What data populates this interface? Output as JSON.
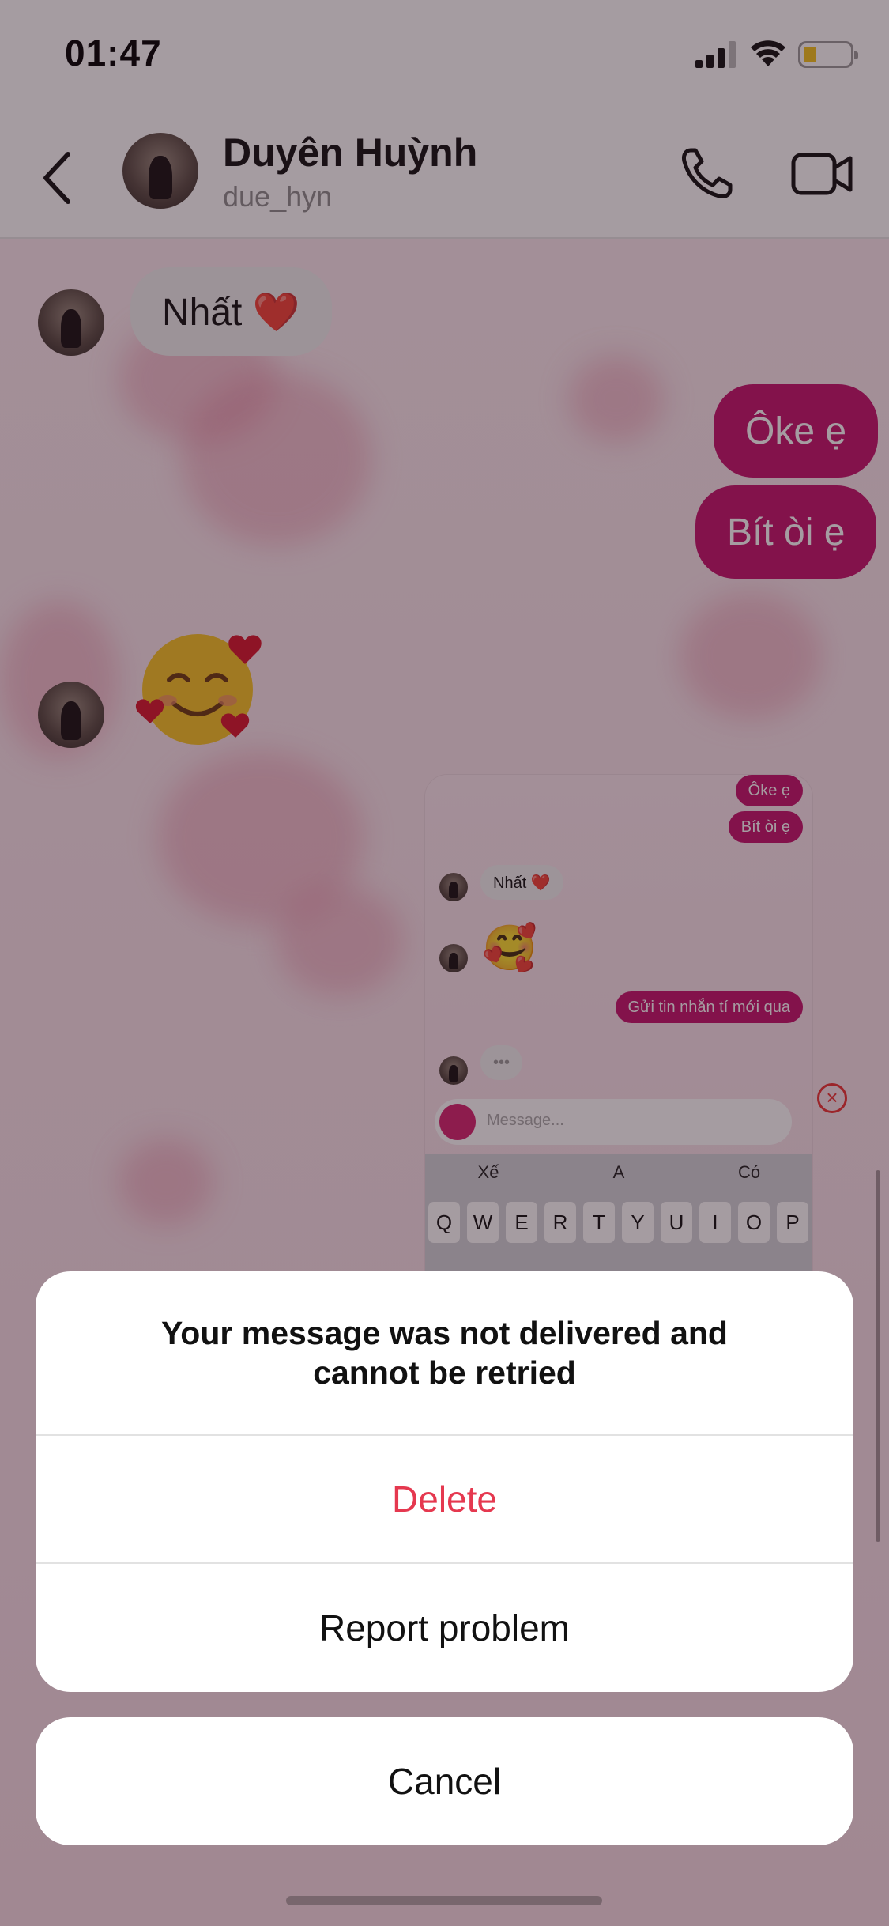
{
  "status_bar": {
    "time": "01:47"
  },
  "header": {
    "contact_name": "Duyên Huỳnh",
    "handle": "due_hyn"
  },
  "messages": {
    "m1": "Nhất ❤️",
    "m2": "Ôke ẹ",
    "m3": "Bít òi ẹ",
    "m4": "☺️"
  },
  "preview": {
    "out1": "Ôke ẹ",
    "out2": "Bít òi ẹ",
    "in1": "Nhất ❤️",
    "emoji": "🥰",
    "out3": "Gửi tin nhắn tí mới qua",
    "typing": "•••",
    "placeholder": "Message...",
    "suggestions": [
      "Xế",
      "A",
      "Có"
    ],
    "keys": [
      "Q",
      "W",
      "E",
      "R",
      "T",
      "Y",
      "U",
      "I",
      "O",
      "P"
    ],
    "close_glyph": "×"
  },
  "action_sheet": {
    "title": "Your message was not delivered and cannot be retried",
    "delete_label": "Delete",
    "report_label": "Report problem",
    "cancel_label": "Cancel"
  },
  "colors": {
    "outgoing_bubble": "#c4126b",
    "destructive": "#e5384f",
    "sheet_bg": "#ffffff"
  }
}
